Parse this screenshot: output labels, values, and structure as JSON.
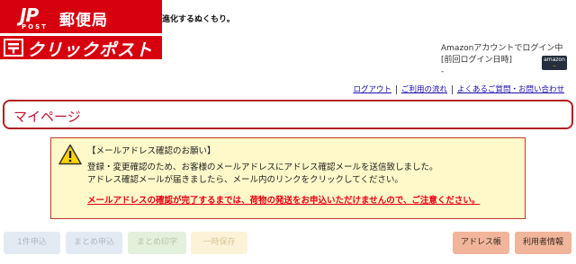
{
  "header": {
    "logo_jp": "JP",
    "logo_post": "POST",
    "logo_brand": "郵便局",
    "logo_service": "クリックポスト",
    "tagline": "進化するぬくもり。"
  },
  "login": {
    "status": "Amazonアカウントでログイン中",
    "last_login_label": "[前回ログイン日時]",
    "last_login_value": "-",
    "badge_line1": "amazon",
    "badge_line2": "pay"
  },
  "toplinks": {
    "logout": "ログアウト",
    "flow": "ご利用の流れ",
    "faq": "よくあるご質問・お問い合わせ"
  },
  "page": {
    "title": "マイページ"
  },
  "notice": {
    "heading": "【メールアドレス確認のお願い】",
    "line1": "登録・変更確認のため、お客様のメールアドレスにアドレス確認メールを送信致しました。",
    "line2": "アドレス確認メールが届きましたら、メール内のリンクをクリックしてください。",
    "alert": "メールアドレスの確認が完了するまでは、荷物の発送をお申込いただけませんので、ご注意ください。"
  },
  "buttons": {
    "single": "1件申込",
    "bulk_apply": "まとめ申込",
    "bulk_print": "まとめ印字",
    "temp_save": "一時保存",
    "address_book": "アドレス帳",
    "user_info": "利用者情報"
  }
}
